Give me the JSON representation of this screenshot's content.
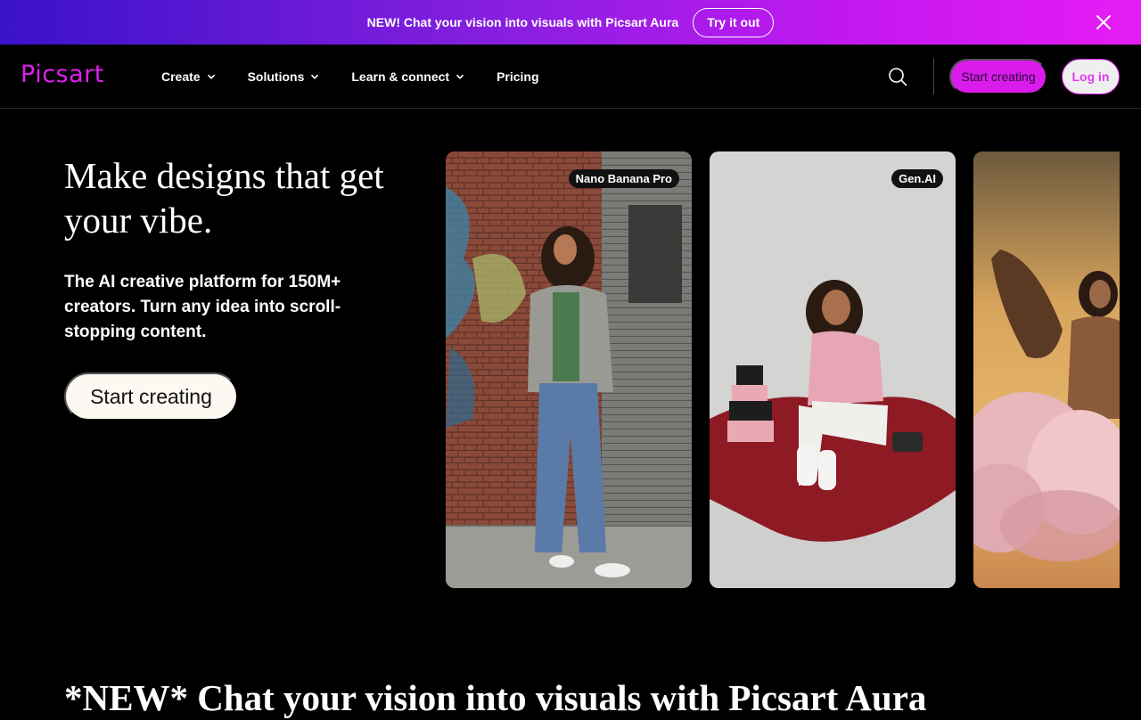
{
  "promo": {
    "text": "NEW! Chat your vision into visuals with Picsart Aura",
    "button": "Try it out"
  },
  "header": {
    "logo": "Picsart",
    "nav": [
      {
        "label": "Create",
        "has_dropdown": true
      },
      {
        "label": "Solutions",
        "has_dropdown": true
      },
      {
        "label": "Learn & connect",
        "has_dropdown": true
      },
      {
        "label": "Pricing",
        "has_dropdown": false
      }
    ],
    "start_button": "Start creating",
    "login_button": "Log in"
  },
  "hero": {
    "title": "Make designs that get your vibe.",
    "subtitle": "The AI creative platform for 150M+ creators. Turn any idea into scroll-stopping content.",
    "cta": "Start creating"
  },
  "cards": [
    {
      "badge": "Nano Banana Pro"
    },
    {
      "badge": "Gen.AI"
    },
    {
      "badge": ""
    }
  ],
  "section": {
    "title": "*NEW* Chat your vision into visuals with Picsart Aura"
  },
  "colors": {
    "brand": "#d91ceb",
    "background": "#000000",
    "cta_bg": "#fdf8f2"
  }
}
